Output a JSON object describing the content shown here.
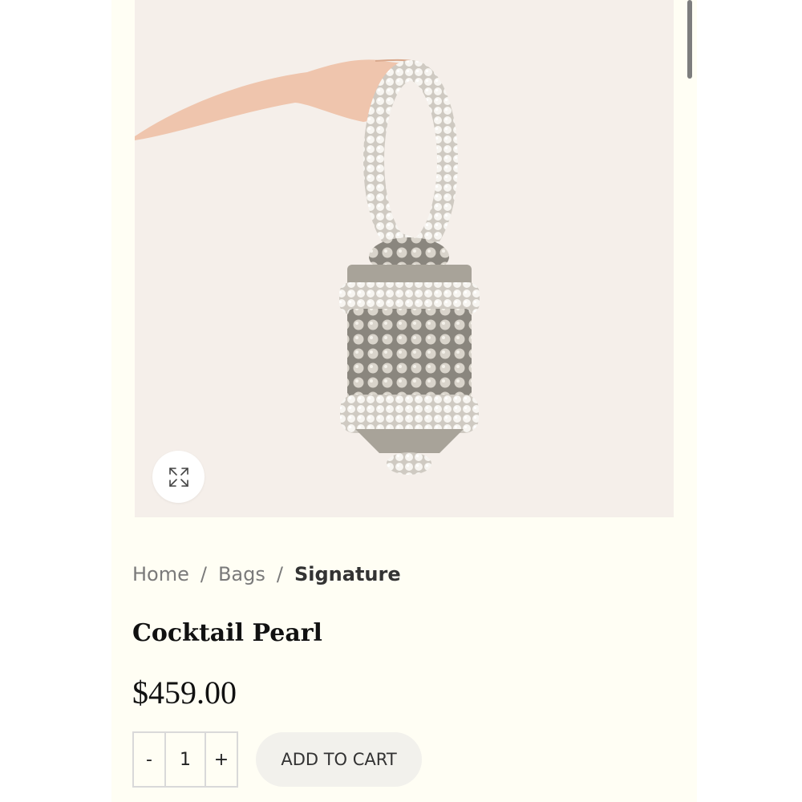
{
  "product": {
    "image_alt": "Cocktail Pearl beaded bag held by hand",
    "title": "Cocktail Pearl",
    "price": "$459.00"
  },
  "breadcrumb": {
    "items": [
      "Home",
      "Bags",
      "Signature"
    ],
    "separator": "/"
  },
  "quantity": {
    "minus_label": "-",
    "value": "1",
    "plus_label": "+"
  },
  "cart": {
    "add_label": "ADD TO CART"
  },
  "icons": {
    "zoom": "expand-arrows-icon"
  },
  "colors": {
    "page_background": "#fffef4",
    "image_background": "#f5efea",
    "button_background": "#f2f1ec",
    "text_primary": "#111111",
    "text_muted": "#7a7a7a"
  }
}
